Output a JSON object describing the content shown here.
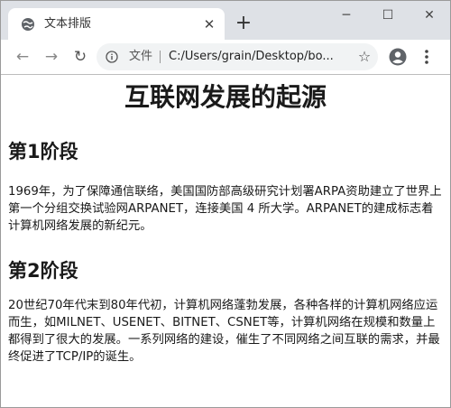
{
  "tab": {
    "title": "文本排版",
    "close_glyph": "✕",
    "new_tab_glyph": "+"
  },
  "window_controls": {
    "minimize": "─",
    "maximize": "☐",
    "close": "✕"
  },
  "toolbar": {
    "back_glyph": "←",
    "forward_glyph": "→",
    "reload_glyph": "↻",
    "scheme_label": "文件",
    "url": "C:/Users/grain/Desktop/bo...",
    "star_glyph": "☆"
  },
  "icons": {
    "tab_favicon": "globe-icon",
    "info": "info-icon",
    "account": "account-icon",
    "menu": "more-vertical-icon"
  },
  "page": {
    "title": "互联网发展的起源",
    "sections": [
      {
        "heading": "第1阶段",
        "body": "1969年，为了保障通信联络，美国国防部高级研究计划署ARPA资助建立了世界上第一个分组交换试验网ARPANET，连接美国 4 所大学。ARPANET的建成标志着计算机网络发展的新纪元。"
      },
      {
        "heading": "第2阶段",
        "body": "20世纪70年代末到80年代初，计算机网络蓬勃发展，各种各样的计算机网络应运而生，如MILNET、USENET、BITNET、CSNET等，计算机网络在规模和数量上都得到了很大的发展。一系列网络的建设，催生了不同网络之间互联的需求，并最终促进了TCP/IP的诞生。"
      }
    ]
  }
}
